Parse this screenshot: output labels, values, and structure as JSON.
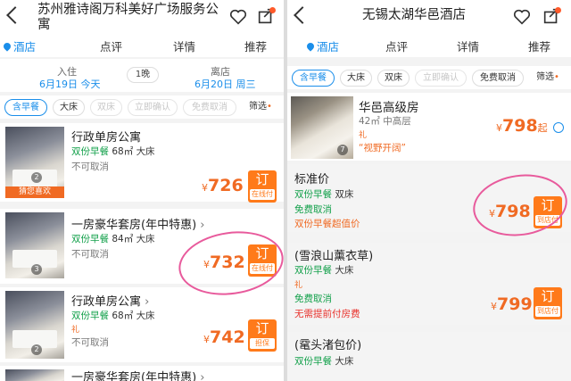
{
  "left": {
    "title": "苏州雅诗阁万科美好广场服务公寓",
    "tabs": [
      "酒店",
      "点评",
      "详情",
      "推荐"
    ],
    "checkin_label": "入住",
    "checkin_date": "6月19日 今天",
    "nights": "1晚",
    "checkout_label": "离店",
    "checkout_date": "6月20日 周三",
    "filters": [
      "含早餐",
      "大床",
      "双床",
      "立即确认",
      "免费取消",
      "筛选"
    ],
    "rooms": [
      {
        "name": "行政单房公寓",
        "breakfast": "双份早餐",
        "area": "68㎡",
        "bed": "大床",
        "cancel": "不可取消",
        "price": "726",
        "book": "订",
        "pay": "在线付",
        "photos": "2",
        "badge": "猜您喜欢"
      },
      {
        "name": "一房豪华套房(年中特惠)",
        "breakfast": "双份早餐",
        "area": "84㎡",
        "bed": "大床",
        "cancel": "不可取消",
        "price": "732",
        "book": "订",
        "pay": "在线付",
        "photos": "3"
      },
      {
        "name": "行政单房公寓",
        "breakfast": "双份早餐",
        "area": "68㎡",
        "bed": "大床",
        "gift": "礼",
        "cancel": "不可取消",
        "price": "742",
        "book": "订",
        "pay": "担保",
        "photos": "2"
      },
      {
        "name": "一房豪华套房(年中特惠)"
      }
    ]
  },
  "right": {
    "title": "无锡太湖华邑酒店",
    "tabs": [
      "酒店",
      "点评",
      "详情",
      "推荐"
    ],
    "filters": [
      "含早餐",
      "大床",
      "双床",
      "立即确认",
      "免费取消",
      "筛选"
    ],
    "room": {
      "name": "华邑高级房",
      "meta": "42㎡ 中高层",
      "gift": "礼",
      "tagline": "“视野开阔”",
      "price": "798",
      "suffix": "起",
      "photos": "7"
    },
    "rates": [
      {
        "name": "标准价",
        "breakfast": "双份早餐",
        "bed": "双床",
        "cancel": "免费取消",
        "note": "双份早餐超值价",
        "price": "798",
        "book": "订",
        "pay": "到店付"
      },
      {
        "name": "(雪浪山薰衣草)",
        "breakfast": "双份早餐",
        "bed": "大床",
        "gift": "礼",
        "cancel": "免费取消",
        "note": "无需提前付房费",
        "price": "799",
        "book": "订",
        "pay": "到店付"
      },
      {
        "name": "(鼋头渚包价)",
        "breakfast": "双份早餐",
        "bed": "大床"
      }
    ]
  }
}
